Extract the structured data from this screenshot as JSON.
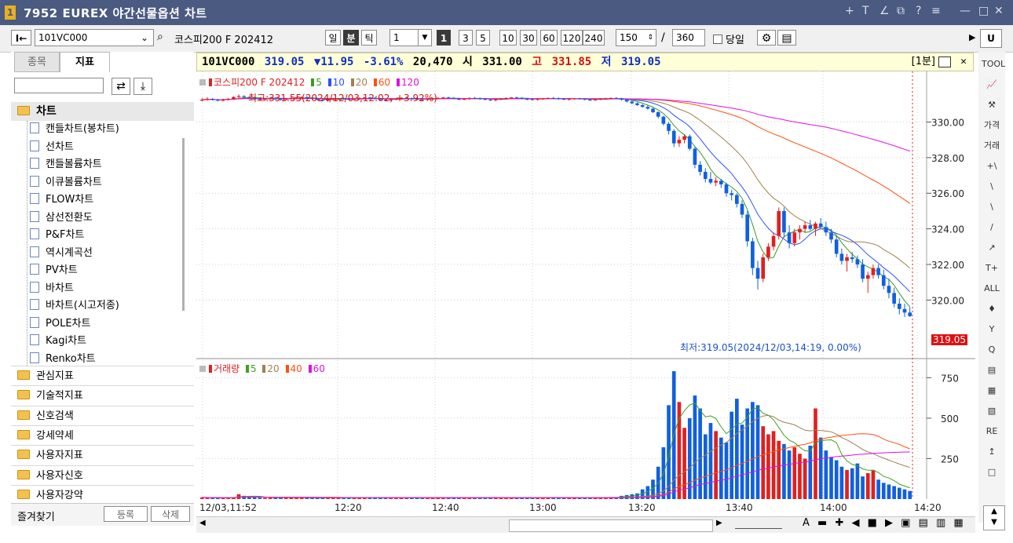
{
  "window": {
    "number": "1",
    "title": "7952 EUREX 야간선물옵션 차트",
    "controls": [
      "+",
      "T",
      "∠",
      "⧉",
      "?",
      "≡",
      "—",
      "□",
      "✕"
    ]
  },
  "toolbar": {
    "first_button": "I←",
    "symbol_code": "101VC000",
    "search_icon": "⌕",
    "symbol_name": "코스피200 F 202412",
    "period_day": "일",
    "period_minute": "분",
    "period_tick": "틱",
    "period_value": "1",
    "interval_buttons": [
      "1",
      "3",
      "5",
      "10",
      "30",
      "60",
      "120",
      "240"
    ],
    "active_interval": "1",
    "display_count": "150",
    "separator": "/",
    "total_count": "360",
    "today_label": "당일",
    "gear_icon": "⚙",
    "save_icon": "▤",
    "right_arrow": "▶",
    "u_button": "U"
  },
  "left_panel": {
    "tabs": [
      "종목",
      "지표"
    ],
    "active_tab": "지표",
    "search_placeholder": "",
    "refresh_icon": "⇄",
    "download_icon": "⤓",
    "root_label": "차트",
    "chart_types": [
      "캔들차트(봉차트)",
      "선차트",
      "캔들볼륨차트",
      "이큐볼륨차트",
      "FLOW차트",
      "삼선전환도",
      "P&F차트",
      "역시계곡선",
      "PV차트",
      "바차트",
      "바차트(시고저종)",
      "POLE차트",
      "Kagi차트",
      "Renko차트"
    ],
    "categories": [
      "관심지표",
      "기술적지표",
      "신호검색",
      "강세약세",
      "사용자지표",
      "사용자신호",
      "사용자강약"
    ],
    "favorites_label": "즐겨찾기",
    "register_button": "등록",
    "delete_button": "삭제"
  },
  "chart_header": {
    "code": "101VC000",
    "price": "319.05",
    "change": "▼11.95",
    "change_pct": "-3.61%",
    "volume": "20,470",
    "open_label": "시",
    "open": "331.00",
    "high_label": "고",
    "high": "331.85",
    "low_label": "저",
    "low": "319.05",
    "interval_tag": "[1분]"
  },
  "price_panel": {
    "legend_name": "코스피200 F 202412",
    "ma_labels": [
      "5",
      "10",
      "20",
      "60",
      "120"
    ],
    "high_annotation": "최고:331.55(2024/12/03,12:02, +3.92%)",
    "low_annotation": "최저:319.05(2024/12/03,14:19,  0.00%)",
    "current_price_tag": "319.05"
  },
  "volume_panel": {
    "legend_name": "거래량",
    "ma_labels": [
      "5",
      "20",
      "40",
      "60"
    ]
  },
  "x_axis": {
    "labels": [
      "12/03,11:52",
      "12:20",
      "12:40",
      "13:00",
      "13:20",
      "13:40",
      "14:00",
      "14:20"
    ]
  },
  "colors": {
    "up": "#e02020",
    "down": "#1060e0",
    "ma5": "#3a9a20",
    "ma10": "#3050ff",
    "ma20": "#a08050",
    "ma60": "#ff5010",
    "ma120": "#e010e0",
    "vol_ma5": "#40a020",
    "vol_ma20": "#a08050",
    "vol_ma40": "#ff5010",
    "vol_ma60": "#e010e0",
    "titlebar": "#4a5a80"
  },
  "right_tools": [
    "TOOL",
    "📈",
    "⚒",
    "가격",
    "거래",
    "+\\",
    "\\",
    "\\",
    "/",
    "↗",
    "T+",
    "ALL",
    "♦",
    "Y",
    "Q",
    "▤",
    "▦",
    "▧",
    "RE",
    "↥",
    "□"
  ],
  "chart_data": {
    "type": "candlestick",
    "x_range": [
      "11:52",
      "14:20"
    ],
    "price_axis": {
      "ticks": [
        330.0,
        328.0,
        326.0,
        324.0,
        322.0,
        320.0
      ],
      "tick_labels": [
        "330.00",
        "328.00",
        "326.00",
        "324.00",
        "322.00",
        "320.00"
      ],
      "ylim": [
        318.3,
        332.4
      ]
    },
    "volume_axis": {
      "ticks": [
        750,
        500,
        250
      ],
      "tick_labels": [
        "750",
        "500",
        "250"
      ],
      "ylim": [
        0,
        800
      ]
    },
    "ohlc": [
      [
        331.2,
        331.35,
        331.15,
        331.25
      ],
      [
        331.25,
        331.4,
        331.2,
        331.3
      ],
      [
        331.3,
        331.35,
        331.2,
        331.25
      ],
      [
        331.25,
        331.3,
        331.15,
        331.2
      ],
      [
        331.2,
        331.3,
        331.15,
        331.28
      ],
      [
        331.28,
        331.35,
        331.2,
        331.3
      ],
      [
        331.3,
        331.45,
        331.25,
        331.4
      ],
      [
        331.4,
        331.55,
        331.35,
        331.45
      ],
      [
        331.45,
        331.5,
        331.35,
        331.4
      ],
      [
        331.4,
        331.45,
        331.3,
        331.35
      ],
      [
        331.35,
        331.4,
        331.25,
        331.3
      ],
      [
        331.3,
        331.35,
        331.2,
        331.28
      ],
      [
        331.28,
        331.35,
        331.2,
        331.3
      ],
      [
        331.3,
        331.38,
        331.25,
        331.32
      ],
      [
        331.32,
        331.4,
        331.25,
        331.3
      ],
      [
        331.3,
        331.35,
        331.2,
        331.25
      ],
      [
        331.25,
        331.35,
        331.2,
        331.3
      ],
      [
        331.3,
        331.4,
        331.25,
        331.35
      ],
      [
        331.35,
        331.4,
        331.3,
        331.38
      ],
      [
        331.38,
        331.45,
        331.3,
        331.4
      ],
      [
        331.4,
        331.45,
        331.3,
        331.35
      ],
      [
        331.35,
        331.4,
        331.25,
        331.3
      ],
      [
        331.3,
        331.35,
        331.2,
        331.25
      ],
      [
        331.25,
        331.3,
        331.15,
        331.2
      ],
      [
        331.2,
        331.3,
        331.15,
        331.28
      ],
      [
        331.28,
        331.35,
        331.2,
        331.3
      ],
      [
        331.3,
        331.35,
        331.25,
        331.32
      ],
      [
        331.32,
        331.38,
        331.25,
        331.3
      ],
      [
        331.3,
        331.35,
        331.22,
        331.25
      ],
      [
        331.25,
        331.32,
        331.2,
        331.3
      ],
      [
        331.3,
        331.38,
        331.25,
        331.35
      ],
      [
        331.35,
        331.4,
        331.3,
        331.38
      ],
      [
        331.38,
        331.42,
        331.3,
        331.35
      ],
      [
        331.35,
        331.4,
        331.28,
        331.3
      ],
      [
        331.3,
        331.35,
        331.22,
        331.25
      ],
      [
        331.25,
        331.3,
        331.18,
        331.22
      ],
      [
        331.22,
        331.3,
        331.18,
        331.28
      ],
      [
        331.28,
        331.35,
        331.22,
        331.3
      ],
      [
        331.3,
        331.38,
        331.25,
        331.35
      ],
      [
        331.35,
        331.4,
        331.3,
        331.32
      ],
      [
        331.32,
        331.38,
        331.25,
        331.3
      ],
      [
        331.3,
        331.35,
        331.22,
        331.28
      ],
      [
        331.28,
        331.33,
        331.2,
        331.25
      ],
      [
        331.25,
        331.32,
        331.2,
        331.3
      ],
      [
        331.3,
        331.35,
        331.25,
        331.32
      ],
      [
        331.32,
        331.4,
        331.28,
        331.35
      ],
      [
        331.35,
        331.4,
        331.3,
        331.38
      ],
      [
        331.38,
        331.42,
        331.32,
        331.35
      ],
      [
        331.35,
        331.4,
        331.28,
        331.3
      ],
      [
        331.3,
        331.35,
        331.22,
        331.28
      ],
      [
        331.28,
        331.35,
        331.22,
        331.3
      ],
      [
        331.3,
        331.38,
        331.25,
        331.35
      ],
      [
        331.35,
        331.4,
        331.3,
        331.32
      ],
      [
        331.32,
        331.38,
        331.25,
        331.3
      ],
      [
        331.3,
        331.35,
        331.22,
        331.25
      ],
      [
        331.25,
        331.3,
        331.18,
        331.22
      ],
      [
        331.22,
        331.3,
        331.15,
        331.28
      ],
      [
        331.28,
        331.35,
        331.22,
        331.3
      ],
      [
        331.3,
        331.38,
        331.25,
        331.35
      ],
      [
        331.35,
        331.4,
        331.3,
        331.38
      ],
      [
        331.38,
        331.42,
        331.3,
        331.35
      ],
      [
        331.35,
        331.4,
        331.28,
        331.3
      ],
      [
        331.3,
        331.35,
        331.22,
        331.28
      ],
      [
        331.28,
        331.33,
        331.2,
        331.25
      ],
      [
        331.25,
        331.32,
        331.2,
        331.3
      ],
      [
        331.3,
        331.35,
        331.25,
        331.32
      ],
      [
        331.32,
        331.38,
        331.28,
        331.35
      ],
      [
        331.35,
        331.4,
        331.3,
        331.33
      ],
      [
        331.33,
        331.38,
        331.25,
        331.3
      ],
      [
        331.3,
        331.35,
        331.22,
        331.28
      ],
      [
        331.28,
        331.33,
        331.2,
        331.3
      ],
      [
        331.3,
        331.35,
        331.25,
        331.32
      ],
      [
        331.32,
        331.36,
        331.25,
        331.3
      ],
      [
        331.3,
        331.34,
        331.22,
        331.25
      ],
      [
        331.25,
        331.3,
        331.18,
        331.22
      ],
      [
        331.22,
        331.3,
        331.18,
        331.28
      ],
      [
        331.28,
        331.34,
        331.22,
        331.3
      ],
      [
        331.3,
        331.36,
        331.25,
        331.33
      ],
      [
        331.33,
        331.38,
        331.28,
        331.35
      ],
      [
        331.35,
        331.4,
        331.3,
        331.32
      ],
      [
        331.32,
        331.36,
        331.2,
        331.25
      ],
      [
        331.25,
        331.3,
        331.1,
        331.15
      ],
      [
        331.15,
        331.2,
        331.0,
        331.05
      ],
      [
        331.05,
        331.1,
        330.9,
        330.95
      ],
      [
        330.95,
        331.0,
        330.8,
        330.85
      ],
      [
        330.85,
        330.95,
        330.7,
        330.75
      ],
      [
        330.75,
        330.8,
        330.5,
        330.55
      ],
      [
        330.55,
        330.6,
        330.2,
        330.3
      ],
      [
        330.3,
        330.35,
        329.8,
        329.9
      ],
      [
        329.9,
        330.0,
        329.3,
        329.5
      ],
      [
        329.5,
        329.6,
        328.6,
        328.8
      ],
      [
        328.8,
        329.2,
        328.6,
        329.0
      ],
      [
        329.0,
        329.3,
        328.8,
        329.2
      ],
      [
        329.2,
        329.3,
        328.4,
        328.5
      ],
      [
        328.5,
        328.6,
        327.4,
        327.6
      ],
      [
        327.6,
        327.8,
        327.0,
        327.2
      ],
      [
        327.2,
        327.4,
        326.6,
        326.8
      ],
      [
        326.8,
        327.2,
        326.5,
        326.6
      ],
      [
        326.6,
        326.9,
        326.4,
        326.7
      ],
      [
        326.7,
        326.8,
        326.3,
        326.5
      ],
      [
        326.5,
        326.6,
        325.8,
        326.0
      ],
      [
        326.0,
        326.2,
        325.6,
        325.9
      ],
      [
        325.9,
        326.0,
        325.2,
        325.4
      ],
      [
        325.4,
        325.6,
        324.6,
        324.8
      ],
      [
        324.8,
        325.0,
        323.0,
        323.3
      ],
      [
        323.3,
        323.5,
        321.4,
        321.8
      ],
      [
        321.8,
        322.2,
        320.6,
        321.2
      ],
      [
        321.2,
        322.6,
        321.0,
        322.4
      ],
      [
        322.4,
        323.2,
        322.2,
        323.0
      ],
      [
        323.0,
        323.8,
        322.8,
        323.6
      ],
      [
        323.6,
        325.2,
        323.4,
        325.0
      ],
      [
        325.0,
        325.2,
        323.5,
        323.8
      ],
      [
        323.8,
        324.2,
        322.9,
        323.2
      ],
      [
        323.2,
        324.0,
        323.0,
        323.8
      ],
      [
        323.8,
        324.2,
        323.4,
        324.0
      ],
      [
        324.0,
        324.4,
        323.8,
        324.2
      ],
      [
        324.2,
        324.5,
        323.9,
        324.0
      ],
      [
        324.0,
        324.4,
        323.6,
        324.3
      ],
      [
        324.3,
        324.6,
        324.0,
        324.1
      ],
      [
        324.1,
        324.4,
        323.6,
        323.8
      ],
      [
        323.8,
        324.0,
        323.2,
        323.4
      ],
      [
        323.4,
        323.6,
        322.4,
        322.6
      ],
      [
        322.6,
        322.9,
        322.0,
        322.2
      ],
      [
        322.2,
        322.6,
        321.6,
        322.4
      ],
      [
        322.4,
        322.7,
        322.1,
        322.3
      ],
      [
        322.3,
        322.5,
        321.8,
        322.0
      ],
      [
        322.0,
        322.3,
        321.0,
        321.2
      ],
      [
        321.2,
        321.6,
        320.4,
        321.4
      ],
      [
        321.4,
        322.0,
        321.2,
        321.8
      ],
      [
        321.8,
        322.0,
        321.2,
        321.4
      ],
      [
        321.4,
        321.7,
        320.6,
        320.8
      ],
      [
        320.8,
        321.2,
        320.1,
        320.4
      ],
      [
        320.4,
        320.7,
        319.6,
        319.8
      ],
      [
        319.8,
        320.1,
        319.2,
        319.5
      ],
      [
        319.5,
        319.8,
        319.05,
        319.3
      ],
      [
        319.3,
        319.6,
        319.05,
        319.1
      ]
    ],
    "volume": [
      10,
      9,
      8,
      8,
      7,
      9,
      12,
      30,
      20,
      15,
      10,
      9,
      8,
      7,
      8,
      9,
      12,
      8,
      7,
      9,
      8,
      7,
      8,
      9,
      7,
      8,
      8,
      7,
      8,
      9,
      8,
      7,
      9,
      10,
      8,
      8,
      7,
      9,
      8,
      7,
      8,
      9,
      8,
      7,
      8,
      9,
      8,
      7,
      9,
      8,
      7,
      8,
      9,
      10,
      8,
      7,
      8,
      9,
      8,
      7,
      9,
      8,
      7,
      8,
      9,
      8,
      10,
      12,
      9,
      8,
      7,
      9,
      8,
      7,
      8,
      9,
      10,
      12,
      11,
      9,
      20,
      25,
      30,
      35,
      60,
      80,
      120,
      200,
      320,
      580,
      790,
      600,
      440,
      500,
      640,
      560,
      400,
      470,
      420,
      380,
      350,
      540,
      620,
      460,
      560,
      600,
      580,
      450,
      400,
      420,
      360,
      340,
      300,
      320,
      280,
      250,
      330,
      560,
      380,
      300,
      260,
      240,
      200,
      180,
      190,
      220,
      140,
      160,
      180,
      120,
      100,
      90,
      80,
      70,
      60,
      50
    ],
    "ma_series": [
      "5",
      "10",
      "20",
      "60",
      "120"
    ],
    "volume_ma_series": [
      "5",
      "20",
      "40",
      "60"
    ]
  }
}
